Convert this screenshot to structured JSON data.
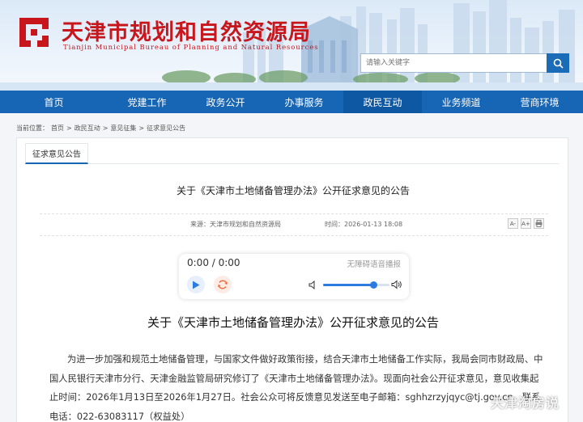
{
  "header": {
    "title": "天津市规划和自然资源局",
    "subtitle": "Tianjin Municipal Bureau of Planning and Natural Resources",
    "search_placeholder": "请输入关键字",
    "brand_color": "#c8161d",
    "logo_icon": "tianjin-planning-logo"
  },
  "nav": {
    "active_index": 5,
    "items": [
      "首页",
      "党建工作",
      "政务公开",
      "办事服务",
      "政民互动",
      "业务频道",
      "营商环境"
    ]
  },
  "breadcrumb": {
    "prefix": "当前位置：",
    "items": [
      "首页",
      "政民互动",
      "意见征集",
      "征求意见公告"
    ],
    "separator": ">"
  },
  "tab": {
    "label": "征求意见公告"
  },
  "article": {
    "title_top": "关于《天津市土地储备管理办法》公开征求意见的公告",
    "source": "来源：天津市规划和自然资源局",
    "time": "时间：2026-01-13 18:08",
    "tools": [
      "A-",
      "A+",
      "print"
    ],
    "title_main": "关于《天津市土地储备管理办法》公开征求意见的公告",
    "body": "为进一步加强和规范土地储备管理，与国家文件做好政策衔接，结合天津市土地储备工作实际，我局会同市财政局、中国人民银行天津市分行、天津金融监管局研究修订了《天津市土地储备管理办法》。现面向社会公开征求意见，意见收集起止时间：2026年1月13日至2026年1月27日。社会公众可将反馈意见发送至电子邮箱：sghhzrzyjqyc@tj.gov.cn。联系电话：022-63083117（权益处）"
  },
  "player": {
    "time": "0:00 / 0:00",
    "label": "无障碍语音播报",
    "volume": 0.75,
    "accent": "#2c7be0"
  },
  "watermark": "天津淘房说"
}
